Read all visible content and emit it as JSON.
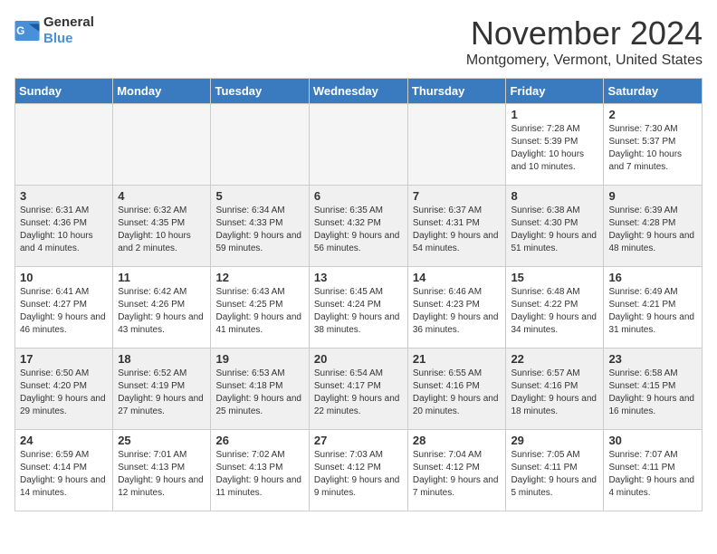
{
  "header": {
    "logo_general": "General",
    "logo_blue": "Blue",
    "month_title": "November 2024",
    "location": "Montgomery, Vermont, United States"
  },
  "days_of_week": [
    "Sunday",
    "Monday",
    "Tuesday",
    "Wednesday",
    "Thursday",
    "Friday",
    "Saturday"
  ],
  "weeks": [
    [
      {
        "day": "",
        "info": ""
      },
      {
        "day": "",
        "info": ""
      },
      {
        "day": "",
        "info": ""
      },
      {
        "day": "",
        "info": ""
      },
      {
        "day": "",
        "info": ""
      },
      {
        "day": "1",
        "info": "Sunrise: 7:28 AM\nSunset: 5:39 PM\nDaylight: 10 hours and 10 minutes."
      },
      {
        "day": "2",
        "info": "Sunrise: 7:30 AM\nSunset: 5:37 PM\nDaylight: 10 hours and 7 minutes."
      }
    ],
    [
      {
        "day": "3",
        "info": "Sunrise: 6:31 AM\nSunset: 4:36 PM\nDaylight: 10 hours and 4 minutes."
      },
      {
        "day": "4",
        "info": "Sunrise: 6:32 AM\nSunset: 4:35 PM\nDaylight: 10 hours and 2 minutes."
      },
      {
        "day": "5",
        "info": "Sunrise: 6:34 AM\nSunset: 4:33 PM\nDaylight: 9 hours and 59 minutes."
      },
      {
        "day": "6",
        "info": "Sunrise: 6:35 AM\nSunset: 4:32 PM\nDaylight: 9 hours and 56 minutes."
      },
      {
        "day": "7",
        "info": "Sunrise: 6:37 AM\nSunset: 4:31 PM\nDaylight: 9 hours and 54 minutes."
      },
      {
        "day": "8",
        "info": "Sunrise: 6:38 AM\nSunset: 4:30 PM\nDaylight: 9 hours and 51 minutes."
      },
      {
        "day": "9",
        "info": "Sunrise: 6:39 AM\nSunset: 4:28 PM\nDaylight: 9 hours and 48 minutes."
      }
    ],
    [
      {
        "day": "10",
        "info": "Sunrise: 6:41 AM\nSunset: 4:27 PM\nDaylight: 9 hours and 46 minutes."
      },
      {
        "day": "11",
        "info": "Sunrise: 6:42 AM\nSunset: 4:26 PM\nDaylight: 9 hours and 43 minutes."
      },
      {
        "day": "12",
        "info": "Sunrise: 6:43 AM\nSunset: 4:25 PM\nDaylight: 9 hours and 41 minutes."
      },
      {
        "day": "13",
        "info": "Sunrise: 6:45 AM\nSunset: 4:24 PM\nDaylight: 9 hours and 38 minutes."
      },
      {
        "day": "14",
        "info": "Sunrise: 6:46 AM\nSunset: 4:23 PM\nDaylight: 9 hours and 36 minutes."
      },
      {
        "day": "15",
        "info": "Sunrise: 6:48 AM\nSunset: 4:22 PM\nDaylight: 9 hours and 34 minutes."
      },
      {
        "day": "16",
        "info": "Sunrise: 6:49 AM\nSunset: 4:21 PM\nDaylight: 9 hours and 31 minutes."
      }
    ],
    [
      {
        "day": "17",
        "info": "Sunrise: 6:50 AM\nSunset: 4:20 PM\nDaylight: 9 hours and 29 minutes."
      },
      {
        "day": "18",
        "info": "Sunrise: 6:52 AM\nSunset: 4:19 PM\nDaylight: 9 hours and 27 minutes."
      },
      {
        "day": "19",
        "info": "Sunrise: 6:53 AM\nSunset: 4:18 PM\nDaylight: 9 hours and 25 minutes."
      },
      {
        "day": "20",
        "info": "Sunrise: 6:54 AM\nSunset: 4:17 PM\nDaylight: 9 hours and 22 minutes."
      },
      {
        "day": "21",
        "info": "Sunrise: 6:55 AM\nSunset: 4:16 PM\nDaylight: 9 hours and 20 minutes."
      },
      {
        "day": "22",
        "info": "Sunrise: 6:57 AM\nSunset: 4:16 PM\nDaylight: 9 hours and 18 minutes."
      },
      {
        "day": "23",
        "info": "Sunrise: 6:58 AM\nSunset: 4:15 PM\nDaylight: 9 hours and 16 minutes."
      }
    ],
    [
      {
        "day": "24",
        "info": "Sunrise: 6:59 AM\nSunset: 4:14 PM\nDaylight: 9 hours and 14 minutes."
      },
      {
        "day": "25",
        "info": "Sunrise: 7:01 AM\nSunset: 4:13 PM\nDaylight: 9 hours and 12 minutes."
      },
      {
        "day": "26",
        "info": "Sunrise: 7:02 AM\nSunset: 4:13 PM\nDaylight: 9 hours and 11 minutes."
      },
      {
        "day": "27",
        "info": "Sunrise: 7:03 AM\nSunset: 4:12 PM\nDaylight: 9 hours and 9 minutes."
      },
      {
        "day": "28",
        "info": "Sunrise: 7:04 AM\nSunset: 4:12 PM\nDaylight: 9 hours and 7 minutes."
      },
      {
        "day": "29",
        "info": "Sunrise: 7:05 AM\nSunset: 4:11 PM\nDaylight: 9 hours and 5 minutes."
      },
      {
        "day": "30",
        "info": "Sunrise: 7:07 AM\nSunset: 4:11 PM\nDaylight: 9 hours and 4 minutes."
      }
    ]
  ]
}
